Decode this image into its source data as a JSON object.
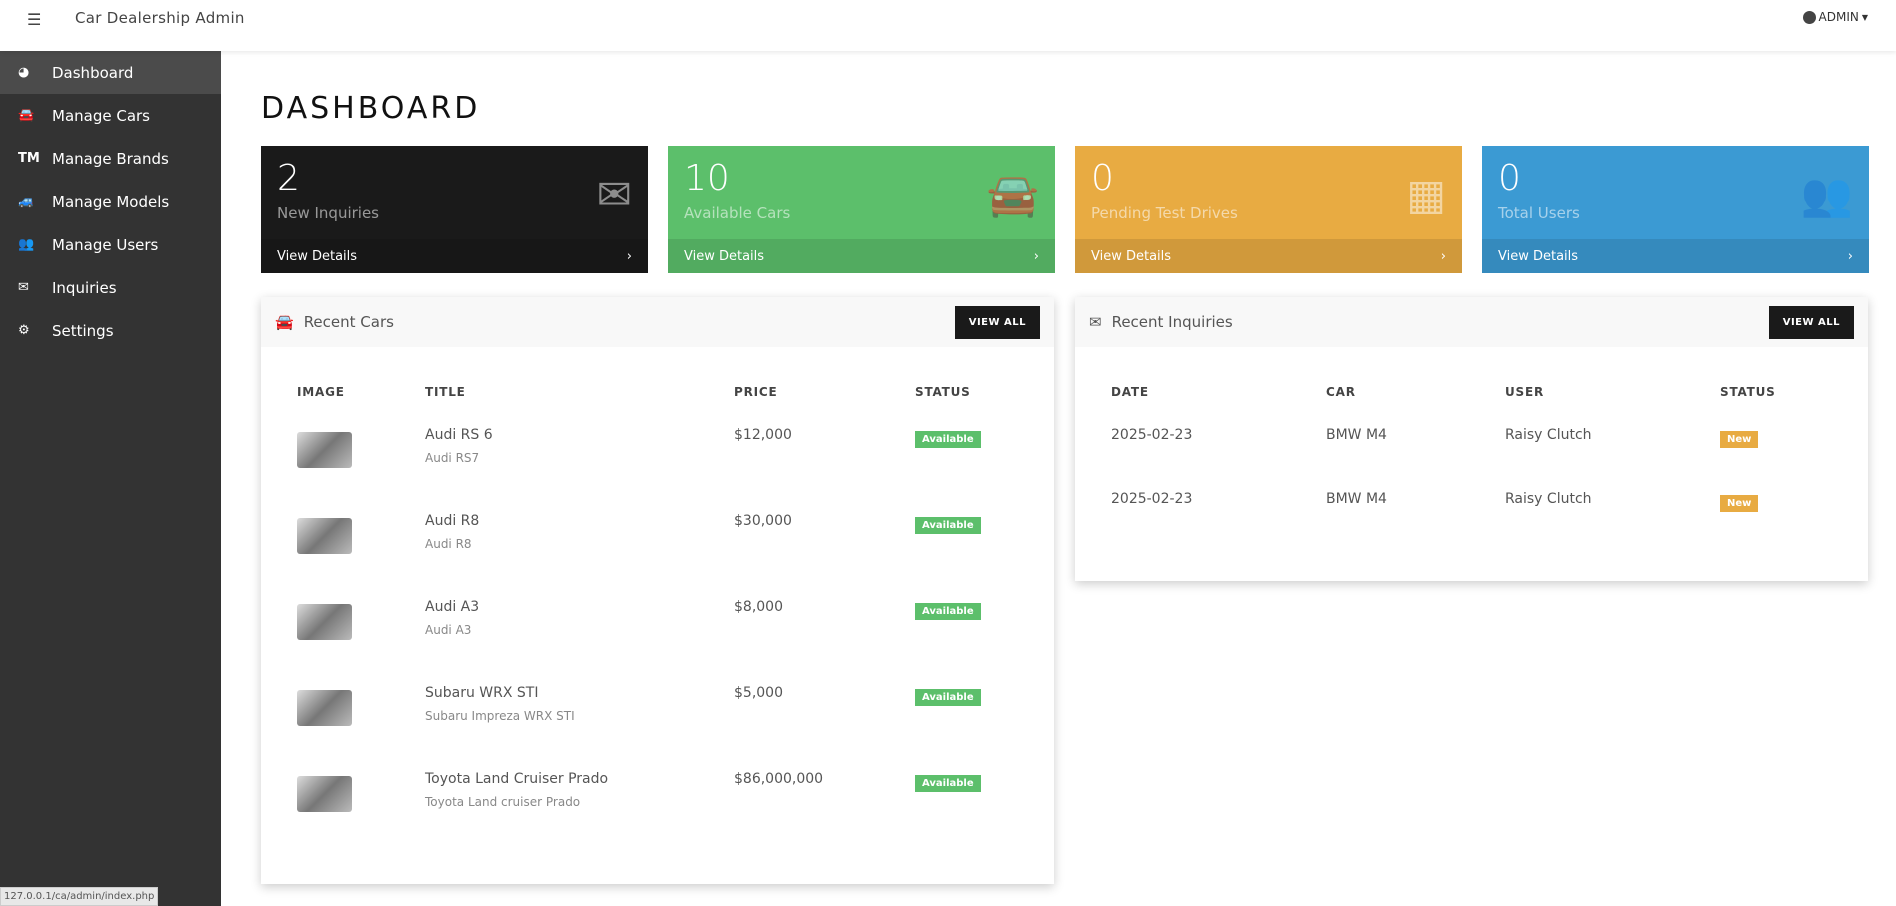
{
  "header": {
    "title": "Car Dealership Admin",
    "user": "ADMIN"
  },
  "sidebar": {
    "items": [
      {
        "label": "Dashboard",
        "icon": "gauge-icon",
        "glyph": "◕"
      },
      {
        "label": "Manage Cars",
        "icon": "car-icon",
        "glyph": "🚘"
      },
      {
        "label": "Manage Brands",
        "icon": "trademark-icon",
        "glyph": "TM"
      },
      {
        "label": "Manage Models",
        "icon": "car-side-icon",
        "glyph": "🚙"
      },
      {
        "label": "Manage Users",
        "icon": "users-icon",
        "glyph": "👥"
      },
      {
        "label": "Inquiries",
        "icon": "envelope-icon",
        "glyph": "✉"
      },
      {
        "label": "Settings",
        "icon": "gear-icon",
        "glyph": "⚙"
      }
    ]
  },
  "page_title": "DASHBOARD",
  "cards": [
    {
      "value": "2",
      "label": "New Inquiries",
      "link": "View Details",
      "color": "#1a1a1a",
      "icon": "envelope-icon",
      "glyph": "✉"
    },
    {
      "value": "10",
      "label": "Available Cars",
      "link": "View Details",
      "color": "#5cbf6b",
      "icon": "car-icon",
      "glyph": "🚘"
    },
    {
      "value": "0",
      "label": "Pending Test Drives",
      "link": "View Details",
      "color": "#e8ab42",
      "icon": "calendar-icon",
      "glyph": "▦"
    },
    {
      "value": "0",
      "label": "Total Users",
      "link": "View Details",
      "color": "#3b9ad3",
      "icon": "users-icon",
      "glyph": "👥"
    }
  ],
  "recent_cars": {
    "title": "Recent Cars",
    "view_all": "VIEW ALL",
    "columns": [
      "IMAGE",
      "TITLE",
      "PRICE",
      "STATUS"
    ],
    "rows": [
      {
        "title": "Audi RS 6",
        "model": "Audi RS7",
        "price": "$12,000",
        "status": "Available"
      },
      {
        "title": "Audi R8",
        "model": "Audi R8",
        "price": "$30,000",
        "status": "Available"
      },
      {
        "title": "Audi A3",
        "model": "Audi A3",
        "price": "$8,000",
        "status": "Available"
      },
      {
        "title": "Subaru WRX STI",
        "model": "Subaru Impreza WRX STI",
        "price": "$5,000",
        "status": "Available"
      },
      {
        "title": "Toyota Land Cruiser Prado",
        "model": "Toyota Land cruiser Prado",
        "price": "$86,000,000",
        "status": "Available"
      }
    ]
  },
  "recent_inquiries": {
    "title": "Recent Inquiries",
    "view_all": "VIEW ALL",
    "columns": [
      "DATE",
      "CAR",
      "USER",
      "STATUS"
    ],
    "rows": [
      {
        "date": "2025-02-23",
        "car": "BMW M4",
        "user": "Raisy Clutch",
        "status": "New"
      },
      {
        "date": "2025-02-23",
        "car": "BMW M4",
        "user": "Raisy Clutch",
        "status": "New"
      }
    ]
  },
  "status_bar": "127.0.0.1/ca/admin/index.php",
  "colors": {
    "available": "#5cbf6b",
    "new": "#e8ab42"
  }
}
